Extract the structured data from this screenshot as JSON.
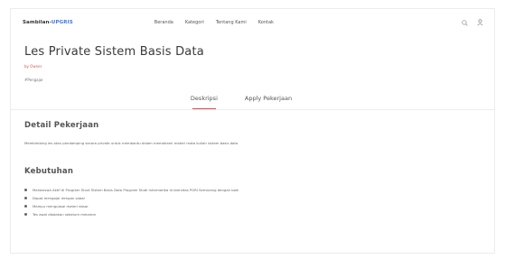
{
  "navbar": {
    "brand_prefix": "Sambilan-",
    "brand_highlight": "UPGRIS",
    "links": [
      "Beranda",
      "Kategori",
      "Tentang Kami",
      "Kontak"
    ]
  },
  "job": {
    "title": "Les Private Sistem Basis Data",
    "company": "by Owner",
    "category": "#Pengajar"
  },
  "tabs": [
    "Deskripsi",
    "Apply Pekerjaan"
  ],
  "detail": {
    "heading": "Detail Pekerjaan",
    "text": "Membimbing les atau pendamping secara private untuk membantu dalam memahami materi mata kuliah sistem basis data"
  },
  "requirements": {
    "heading": "Kebutuhan",
    "items": [
      "Mahasiswa Aktif di Program Studi Sistem Basis Data Program Studi Informatika Universitas PGRI Semarang dengan baik",
      "Dapat mengajar dengan sabar",
      "Mampu menguasai materi dasar",
      "Tes awal diadakan sebelum melamar"
    ]
  }
}
